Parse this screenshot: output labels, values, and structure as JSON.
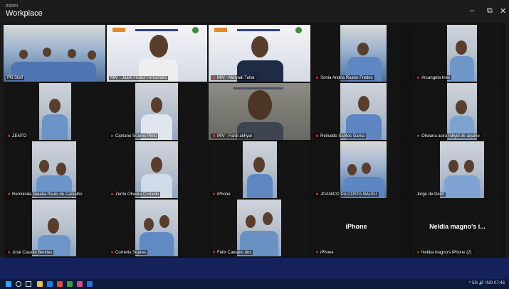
{
  "app": {
    "small_label": "zoom",
    "title": "Workplace"
  },
  "window_controls": {
    "minimize": "–",
    "restore": "⧉",
    "close": "✕"
  },
  "participants": [
    {
      "id": "p1",
      "name": "PN Staff",
      "muted": false,
      "kind": "video",
      "style": "group"
    },
    {
      "id": "p2",
      "name": "MIV - Juam Frukul Fernandes",
      "muted": false,
      "kind": "video",
      "style": "banner",
      "speaking": true
    },
    {
      "id": "p3",
      "name": "MIV - Mulyadi Tullat",
      "muted": true,
      "kind": "video",
      "style": "banner"
    },
    {
      "id": "p4",
      "name": "Sonia Andria Ruano Fredes",
      "muted": true,
      "kind": "video",
      "style": "group"
    },
    {
      "id": "p5",
      "name": "Arcangela Ines",
      "muted": true,
      "kind": "video",
      "style": "plain"
    },
    {
      "id": "p6",
      "name": "ZENTO",
      "muted": true,
      "kind": "video",
      "style": "plain"
    },
    {
      "id": "p7",
      "name": "Cipriano Soares Pinto",
      "muted": true,
      "kind": "video",
      "style": "plain"
    },
    {
      "id": "p8",
      "name": "MIV - Fardi akhyar",
      "muted": true,
      "kind": "video",
      "style": "dark"
    },
    {
      "id": "p9",
      "name": "Reinaldo Santos Gama",
      "muted": true,
      "kind": "video",
      "style": "plain"
    },
    {
      "id": "p10",
      "name": "Oliviana acira lobyid de aquino",
      "muted": true,
      "kind": "video",
      "style": "plain"
    },
    {
      "id": "p11",
      "name": "Remoinda Natalia Paulo de Carvalho",
      "muted": true,
      "kind": "video",
      "style": "plain"
    },
    {
      "id": "p12",
      "name": "Zento  Oliveira Cornelio",
      "muted": true,
      "kind": "video",
      "style": "plain"
    },
    {
      "id": "p13",
      "name": "iPhone",
      "muted": true,
      "kind": "video",
      "style": "plain"
    },
    {
      "id": "p14",
      "name": "JOANICO DA COSTA NALEU",
      "muted": true,
      "kind": "video",
      "style": "group"
    },
    {
      "id": "p15",
      "name": "Jorge de Deus",
      "muted": false,
      "kind": "video",
      "style": "plain"
    },
    {
      "id": "p16",
      "name": "José Claudio Benites",
      "muted": true,
      "kind": "video",
      "style": "plain"
    },
    {
      "id": "p17",
      "name": "Cornelio Soares",
      "muted": true,
      "kind": "video",
      "style": "plain"
    },
    {
      "id": "p18",
      "name": "Felix Caetano dos",
      "muted": true,
      "kind": "video",
      "style": "plain"
    },
    {
      "id": "p19",
      "name": "iPhone",
      "muted": true,
      "kind": "name-only",
      "display": "iPhone"
    },
    {
      "id": "p20",
      "name": "Neldia magno's iPhone (2)",
      "muted": true,
      "kind": "name-only",
      "display": "Neldia magno's i..."
    }
  ],
  "taskbar": {
    "tray": "^ 5G 🔊  IND  07:46"
  }
}
